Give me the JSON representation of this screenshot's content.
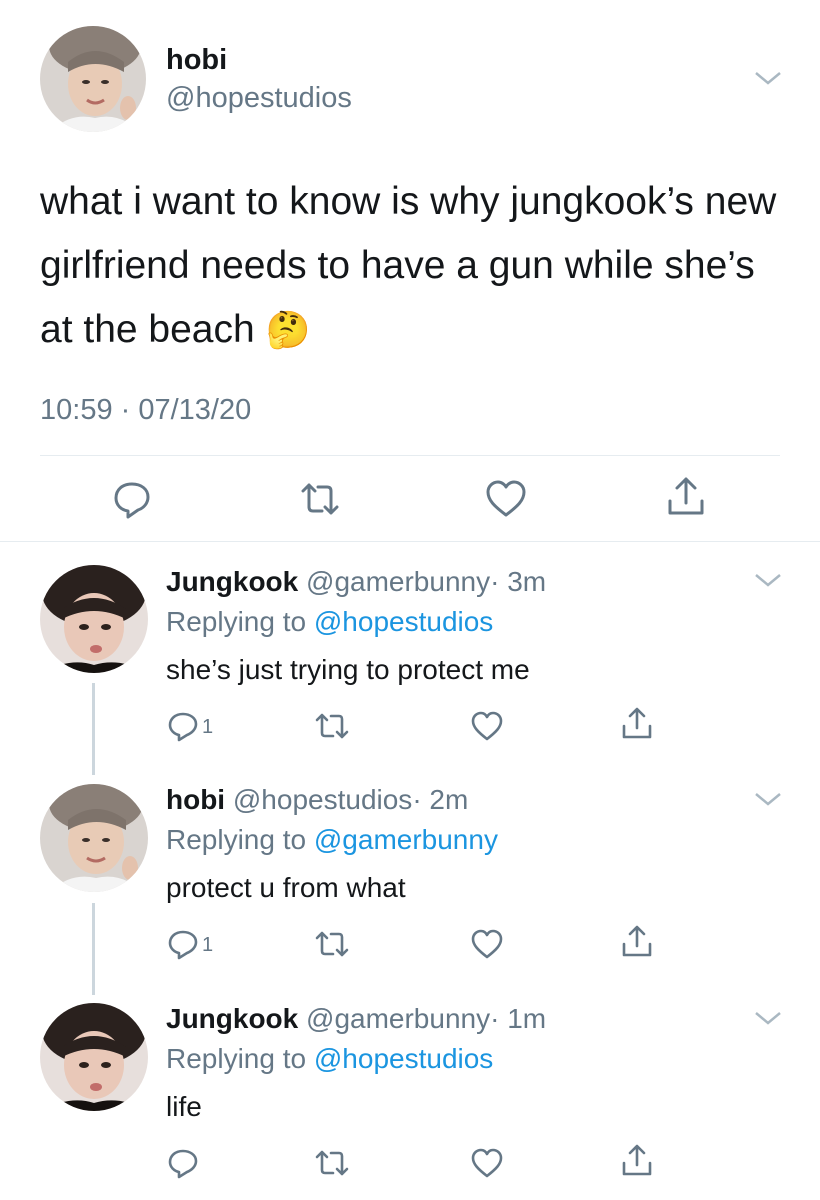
{
  "main_tweet": {
    "name": "hobi",
    "handle": "@hopestudios",
    "text": "what i want to know is why jungkook’s new girlfriend needs to have a gun while she’s at the beach",
    "emoji": "🤔",
    "timestamp": "10:59 · 07/13/20",
    "icons": [
      "reply-icon",
      "retweet-icon",
      "like-icon",
      "share-icon"
    ]
  },
  "replies": [
    {
      "name": "Jungkook",
      "handle": "@gamerbunny",
      "time": "· 3m",
      "replying_prefix": "Replying to",
      "replying_to": "@hopestudios",
      "text": "she’s just trying to protect me",
      "reply_count": "1"
    },
    {
      "name": "hobi",
      "handle": "@hopestudios",
      "time": "· 2m",
      "replying_prefix": "Replying to",
      "replying_to": "@gamerbunny",
      "text": "protect u from what",
      "reply_count": "1"
    },
    {
      "name": "Jungkook",
      "handle": "@gamerbunny",
      "time": "· 1m",
      "replying_prefix": "Replying to",
      "replying_to": "@hopestudios",
      "text": "life",
      "reply_count": ""
    }
  ],
  "colors": {
    "text": "#14171a",
    "muted": "#657786",
    "link": "#1b95e0",
    "divider": "#e6ecf0",
    "thread_line": "#ccd6dd"
  }
}
